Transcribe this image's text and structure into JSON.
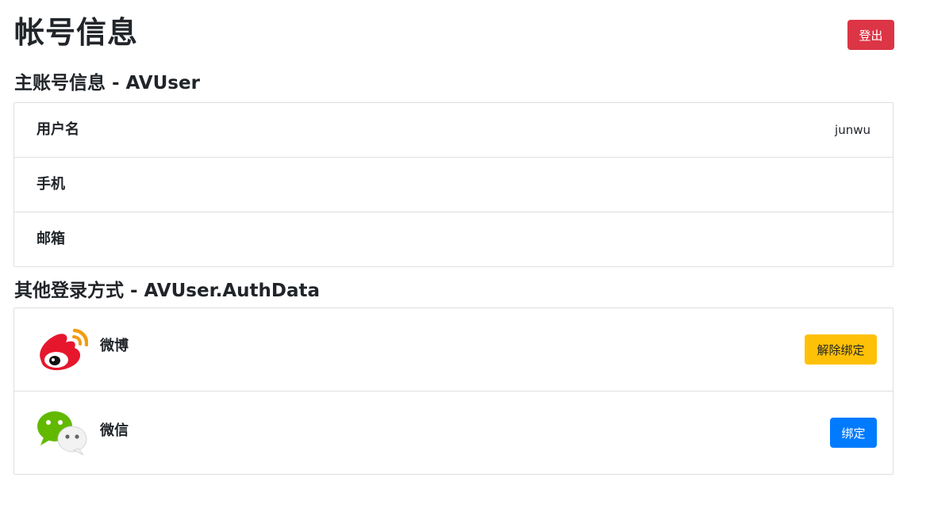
{
  "header": {
    "title": "帐号信息",
    "logout_label": "登出"
  },
  "primary_section": {
    "title": "主账号信息 - AVUser",
    "fields": [
      {
        "label": "用户名",
        "value": "junwu"
      },
      {
        "label": "手机",
        "value": ""
      },
      {
        "label": "邮箱",
        "value": ""
      }
    ]
  },
  "auth_section": {
    "title": "其他登录方式 - AVUser.AuthData",
    "providers": [
      {
        "name": "微博",
        "icon": "weibo-icon",
        "action_label": "解除绑定",
        "bound": true
      },
      {
        "name": "微信",
        "icon": "wechat-icon",
        "action_label": "绑定",
        "bound": false
      }
    ]
  },
  "colors": {
    "danger": "#dc3545",
    "warning": "#ffc107",
    "primary": "#007bff",
    "border": "#dfdfdf"
  }
}
